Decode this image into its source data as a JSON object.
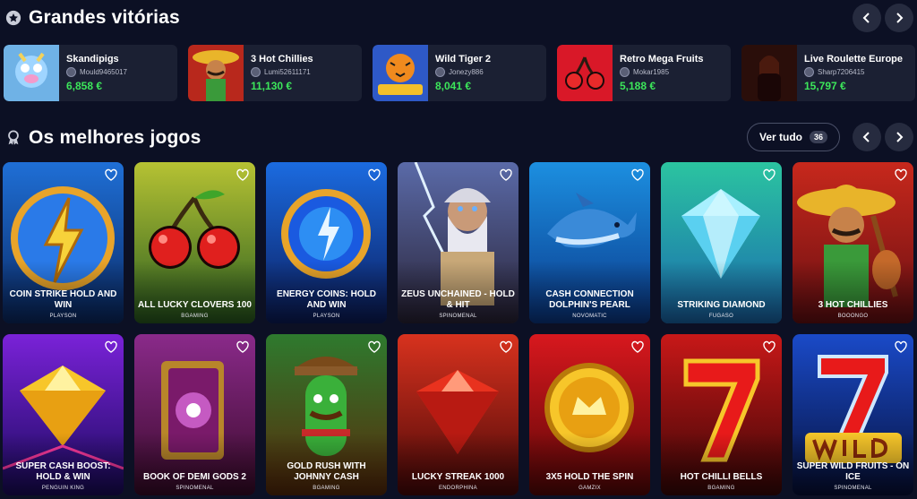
{
  "big_wins": {
    "title": "Grandes vitórias",
    "icon": "star-circle-icon",
    "items": [
      {
        "game": "Skandipigs",
        "user": "Mould9465017",
        "amount": "6,858 €",
        "thumb": "#7ab7e8"
      },
      {
        "game": "3 Hot Chillies",
        "user": "Lumi52611171",
        "amount": "11,130 €",
        "thumb": "#b8281c"
      },
      {
        "game": "Wild Tiger 2",
        "user": "Jonezy886",
        "amount": "8,041 €",
        "thumb": "#2e59c7"
      },
      {
        "game": "Retro Mega Fruits",
        "user": "Mokar1985",
        "amount": "5,188 €",
        "thumb": "#d91828"
      },
      {
        "game": "Live Roulette Europe",
        "user": "Sharp7206415",
        "amount": "15,797 €",
        "thumb": "#3a1410"
      }
    ]
  },
  "best_games": {
    "title": "Os melhores jogos",
    "icon": "ribbon-award-icon",
    "see_all_label": "Ver tudo",
    "see_all_count": "36",
    "games": [
      {
        "title": "Coin Strike Hold and Win",
        "provider": "Playson",
        "c1": "#1f6fd6",
        "c2": "#0a2a66",
        "art": "bolt"
      },
      {
        "title": "All Lucky Clovers 100",
        "provider": "BGaming",
        "c1": "#b6c233",
        "c2": "#2a5e20",
        "art": "cherry"
      },
      {
        "title": "Energy Coins: Hold and Win",
        "provider": "Playson",
        "c1": "#1b6be0",
        "c2": "#0b1d5e",
        "art": "coin"
      },
      {
        "title": "Zeus Unchained - Hold & Hit",
        "provider": "Spinomenal",
        "c1": "#5a6aa8",
        "c2": "#2a2438",
        "art": "zeus"
      },
      {
        "title": "Cash Connection Dolphin's Pearl",
        "provider": "Novomatic",
        "c1": "#1c8fe0",
        "c2": "#0a3a8c",
        "art": "dolphin"
      },
      {
        "title": "Striking Diamond",
        "provider": "Fugaso",
        "c1": "#2bc4a0",
        "c2": "#1a6ab0",
        "art": "diamond"
      },
      {
        "title": "3 Hot Chillies",
        "provider": "Booongo",
        "c1": "#c7281c",
        "c2": "#6a0f12",
        "art": "mexican"
      },
      {
        "title": "Super Cash Boost: Hold & Win",
        "provider": "Penguin King",
        "c1": "#7a22d8",
        "c2": "#1a0a5e",
        "art": "gem"
      },
      {
        "title": "Book of Demi Gods 2",
        "provider": "Spinomenal",
        "c1": "#8a2a8a",
        "c2": "#3a0a2a",
        "art": "book"
      },
      {
        "title": "Gold Rush with Johnny Cash",
        "provider": "BGaming",
        "c1": "#2e7a2e",
        "c2": "#5a2a0a",
        "art": "cactus"
      },
      {
        "title": "Lucky Streak 1000",
        "provider": "Endorphina",
        "c1": "#d8321e",
        "c2": "#4a0808",
        "art": "ruby"
      },
      {
        "title": "3x5 Hold the Spin",
        "provider": "Gamzix",
        "c1": "#d8181e",
        "c2": "#5a0606",
        "art": "goldcoin"
      },
      {
        "title": "Hot Chilli Bells",
        "provider": "BGaming",
        "c1": "#c81818",
        "c2": "#3a0606",
        "art": "seven"
      },
      {
        "title": "Super Wild Fruits - On Ice",
        "provider": "Spinomenal",
        "c1": "#1a4ac8",
        "c2": "#06103a",
        "art": "wild7"
      }
    ]
  },
  "colors": {
    "accent_green": "#3ce65a",
    "background": "#0c1024",
    "card": "#1b2033"
  }
}
